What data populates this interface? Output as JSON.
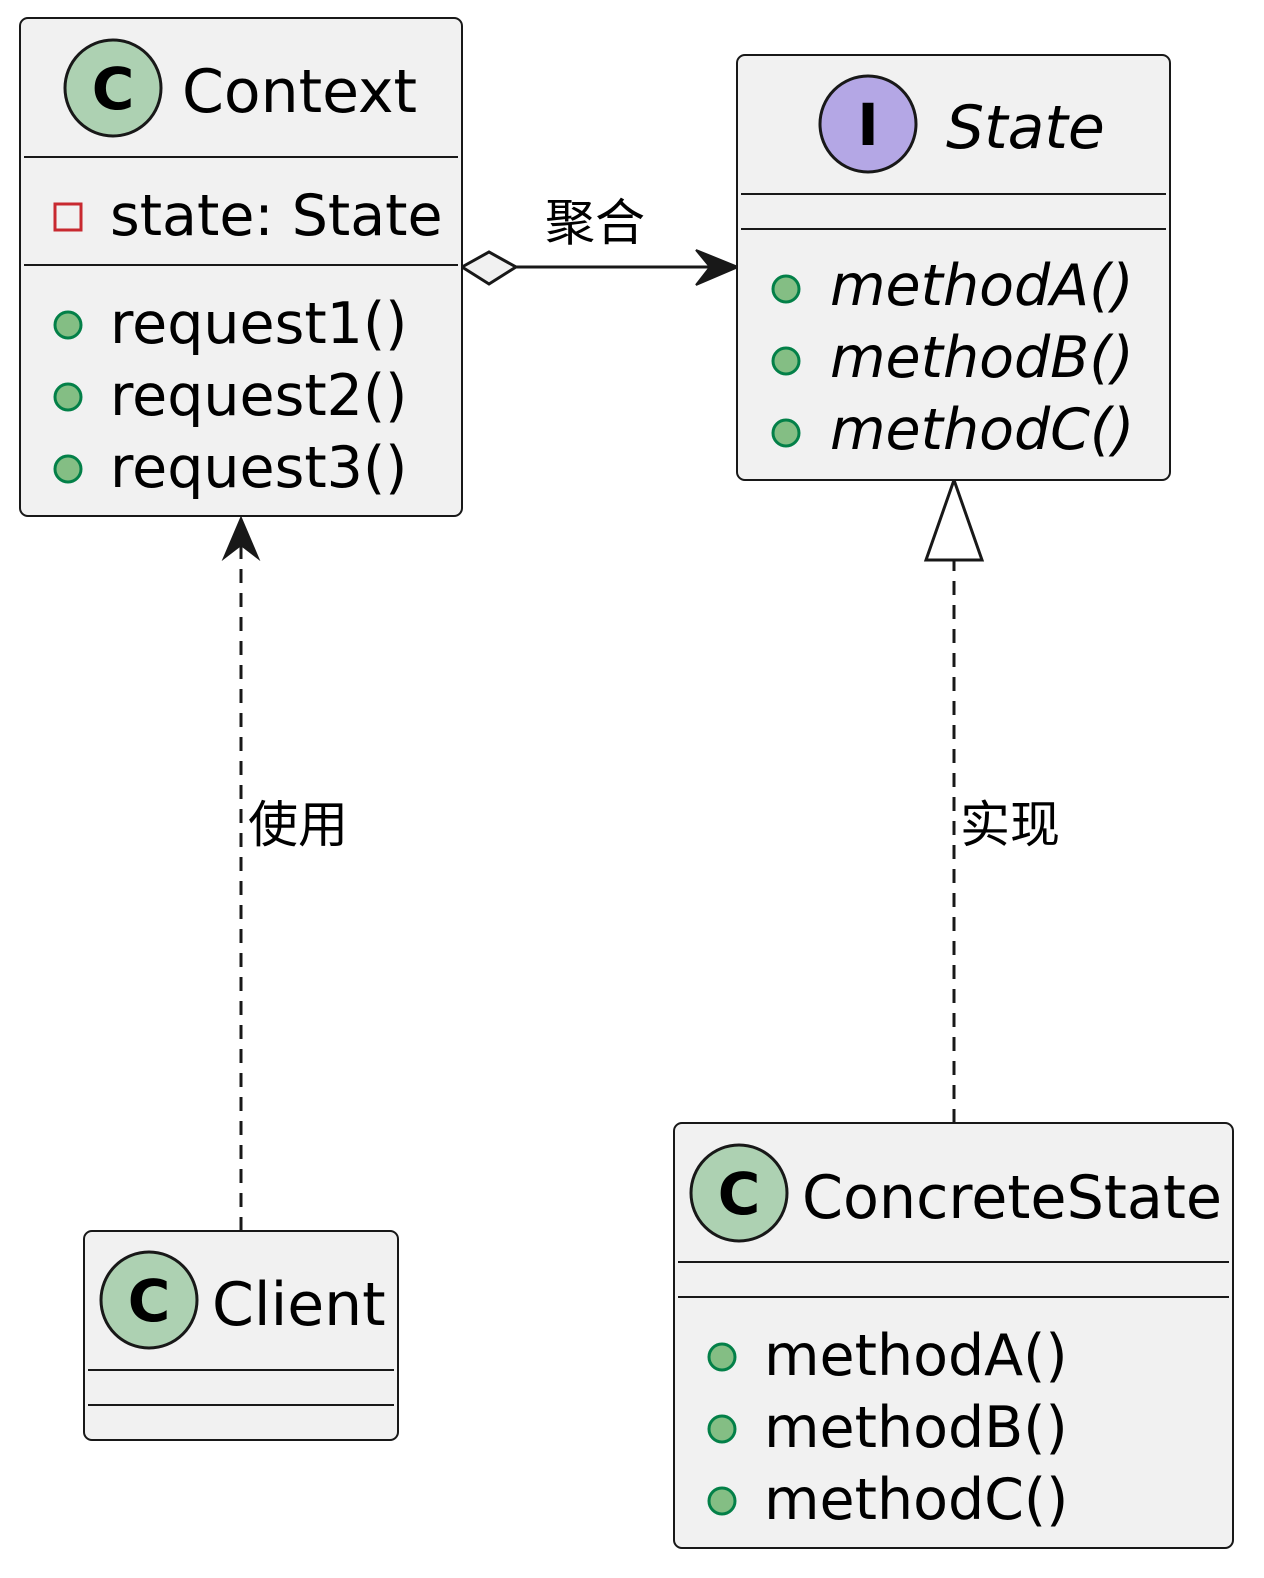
{
  "classes": {
    "context": {
      "stereotype_glyph": "C",
      "name": "Context",
      "attributes": [
        {
          "visibility": "private",
          "text": "state: State"
        }
      ],
      "methods": [
        {
          "visibility": "public",
          "text": "request1()"
        },
        {
          "visibility": "public",
          "text": "request2()"
        },
        {
          "visibility": "public",
          "text": "request3()"
        }
      ]
    },
    "state": {
      "stereotype_glyph": "I",
      "name": "State",
      "kind": "interface",
      "methods": [
        {
          "visibility": "public",
          "text": "methodA()"
        },
        {
          "visibility": "public",
          "text": "methodB()"
        },
        {
          "visibility": "public",
          "text": "methodC()"
        }
      ]
    },
    "client": {
      "stereotype_glyph": "C",
      "name": "Client"
    },
    "concrete": {
      "stereotype_glyph": "C",
      "name": "ConcreteState",
      "methods": [
        {
          "visibility": "public",
          "text": "methodA()"
        },
        {
          "visibility": "public",
          "text": "methodB()"
        },
        {
          "visibility": "public",
          "text": "methodC()"
        }
      ]
    }
  },
  "relations": {
    "aggregation": {
      "from": "Context",
      "to": "State",
      "label": "聚合"
    },
    "usage": {
      "from": "Client",
      "to": "Context",
      "label": "使用"
    },
    "realization": {
      "from": "ConcreteState",
      "to": "State",
      "label": "实现"
    }
  },
  "colors": {
    "box": "#F1F1F1",
    "class_icon": "#ADD1B2",
    "interface_icon": "#B4A7E5",
    "public": "#84BE84",
    "private": "#C82930"
  }
}
